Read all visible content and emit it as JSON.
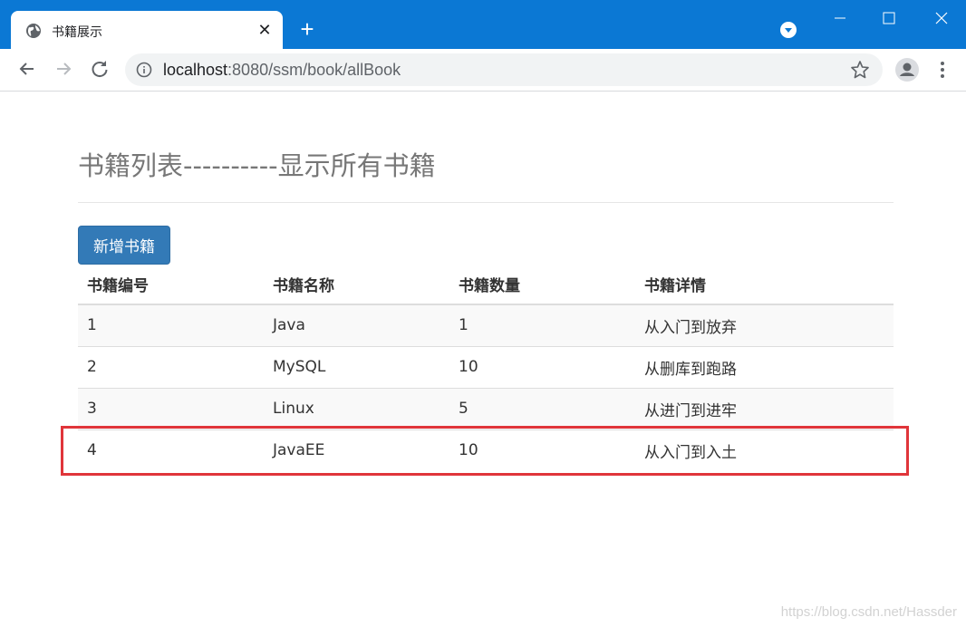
{
  "browser": {
    "tab": {
      "title": "书籍展示",
      "favicon": "globe-icon"
    },
    "new_tab": "+",
    "address": {
      "host": "localhost",
      "path": ":8080/ssm/book/allBook"
    },
    "accent_color": "#0b78d4"
  },
  "page": {
    "title": "书籍列表----------显示所有书籍",
    "add_button": "新增书籍",
    "table": {
      "headers": [
        "书籍编号",
        "书籍名称",
        "书籍数量",
        "书籍详情"
      ],
      "rows": [
        [
          "1",
          "Java",
          "1",
          "从入门到放弃"
        ],
        [
          "2",
          "MySQL",
          "10",
          "从删库到跑路"
        ],
        [
          "3",
          "Linux",
          "5",
          "从进门到进牢"
        ],
        [
          "4",
          "JavaEE",
          "10",
          "从入门到入土"
        ]
      ]
    },
    "highlighted_row": 4,
    "highlight_color": "#e0353a",
    "button_color": "#337ab7"
  },
  "watermark": "https://blog.csdn.net/Hassder"
}
